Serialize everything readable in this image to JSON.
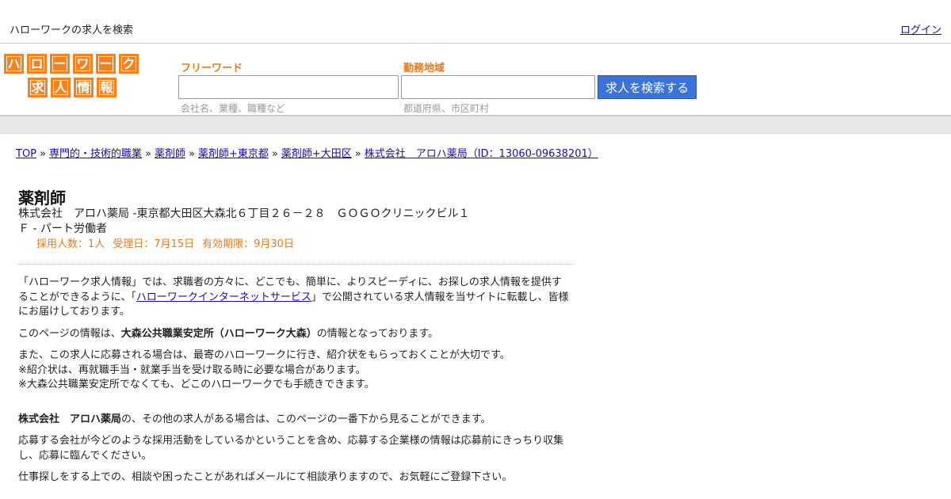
{
  "topbar": {
    "site_title": "ハローワークの求人を検索",
    "login": "ログイン"
  },
  "logo": {
    "row1": [
      "ハ",
      "ロ",
      "ー",
      "ワ",
      "ー",
      "ク"
    ],
    "row2": [
      "求",
      "人",
      "情",
      "報"
    ]
  },
  "search": {
    "keyword_label": "フリーワード",
    "keyword_value": "",
    "keyword_hint": "会社名、業種、職種など",
    "area_label": "勤務地域",
    "area_value": "",
    "area_hint": "都道府県、市区町村",
    "button": "求人を検索する"
  },
  "breadcrumb": [
    "TOP",
    "専門的・技術的職業",
    "薬剤師",
    "薬剤師+東京都",
    "薬剤師+大田区",
    "株式会社　アロハ薬局（ID：13060-09638201）"
  ],
  "breadcrumb_sep": "»",
  "job": {
    "title": "薬剤師",
    "company_line": "株式会社　アロハ薬局 -東京都大田区大森北６丁目２６－２８　ＧＯＧＯクリニックビル１",
    "type_line": "Ｆ - パート労働者",
    "hires": "採用人数：1人",
    "received": "受理日：7月15日",
    "expiry": "有効期限：9月30日"
  },
  "body": {
    "p1_before": "「ハローワーク求人情報」では、求職者の方々に、どこでも、簡単に、よりスピーディに、お探しの求人情報を提供することができるように、「",
    "p1_link": "ハローワークインターネットサービス",
    "p1_after": "」で公開されている求人情報を当サイトに転載し、皆様にお届けしております。",
    "p2_before": "このページの情報は、",
    "p2_strong": "大森公共職業安定所（ハローワーク大森）",
    "p2_after": "の情報となっております。",
    "p3_l1": "また、この求人に応募される場合は、最寄のハローワークに行き、紹介状をもらっておくことが大切です。",
    "p3_l2": "※紹介状は、再就職手当・就業手当を受け取る時に必要な場合があります。",
    "p3_l3": "※大森公共職業安定所でなくても、どこのハローワークでも手続きできます。",
    "p4_strong": "株式会社　アロハ薬局",
    "p4_after": "の、その他の求人がある場合は、このページの一番下から見ることができます。",
    "p5": "応募する会社が今どのような採用活動をしているかということを含め、応募する企業様の情報は応募前にきっちり収集し、応募に臨んでください。",
    "p6": "仕事探しをする上での、相談や困ったことがあればメールにて相談承りますので、お気軽にご登録下さい。"
  },
  "colors": {
    "accent_orange": "#f5821f",
    "label_orange": "#e87a1a",
    "button_blue": "#3b73d9",
    "link": "#1a0dab"
  }
}
